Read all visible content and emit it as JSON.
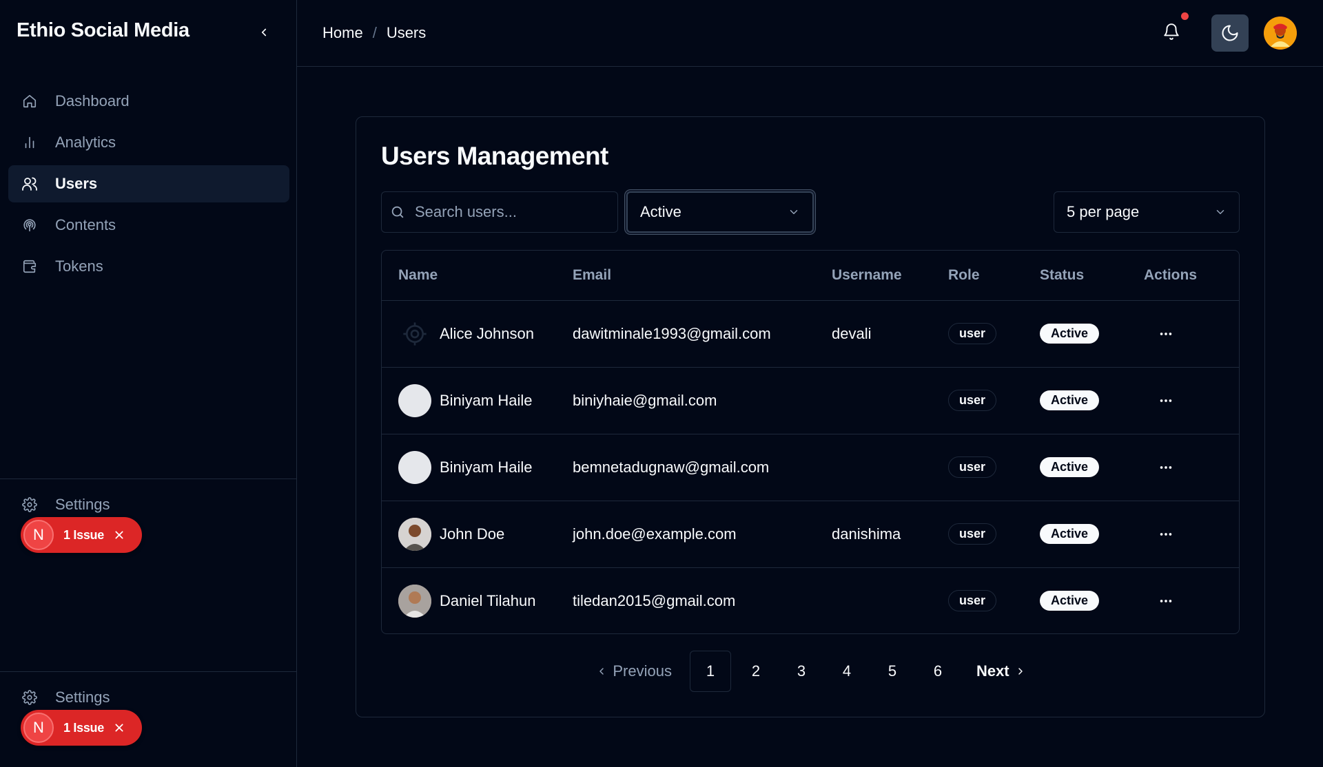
{
  "brand": "Ethio Social Media",
  "sidebar": {
    "items": [
      {
        "label": "Dashboard",
        "icon": "home-icon"
      },
      {
        "label": "Analytics",
        "icon": "bar-chart-icon"
      },
      {
        "label": "Users",
        "icon": "users-icon",
        "active": true
      },
      {
        "label": "Contents",
        "icon": "podcast-icon"
      },
      {
        "label": "Tokens",
        "icon": "wallet-icon"
      }
    ],
    "settings_label": "Settings",
    "issue_badge": {
      "logo": "N",
      "text": "1 Issue"
    }
  },
  "header": {
    "breadcrumb": {
      "home": "Home",
      "separator": "/",
      "current": "Users"
    }
  },
  "main": {
    "title": "Users Management",
    "search_placeholder": "Search users...",
    "status_filter": "Active",
    "per_page": "5 per page",
    "columns": [
      "Name",
      "Email",
      "Username",
      "Role",
      "Status",
      "Actions"
    ],
    "rows": [
      {
        "name": "Alice Johnson",
        "email": "dawitminale1993@gmail.com",
        "username": "devali",
        "role": "user",
        "status": "Active",
        "avatar": "gear"
      },
      {
        "name": "Biniyam Haile",
        "email": "biniyhaie@gmail.com",
        "username": "",
        "role": "user",
        "status": "Active",
        "avatar": "blank"
      },
      {
        "name": "Biniyam Haile",
        "email": "bemnetadugnaw@gmail.com",
        "username": "",
        "role": "user",
        "status": "Active",
        "avatar": "blank"
      },
      {
        "name": "John Doe",
        "email": "john.doe@example.com",
        "username": "danishima",
        "role": "user",
        "status": "Active",
        "avatar": "photo1"
      },
      {
        "name": "Daniel Tilahun",
        "email": "tiledan2015@gmail.com",
        "username": "",
        "role": "user",
        "status": "Active",
        "avatar": "photo2"
      }
    ],
    "pagination": {
      "previous": "Previous",
      "next": "Next",
      "pages": [
        "1",
        "2",
        "3",
        "4",
        "5",
        "6"
      ],
      "current": "1"
    }
  },
  "colors": {
    "background": "#020817",
    "border": "#1e293b",
    "issue": "#dc2626",
    "notification_dot": "#ef4444"
  }
}
